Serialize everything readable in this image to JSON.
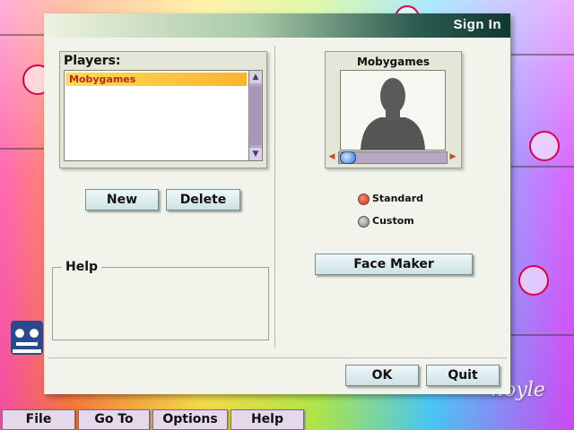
{
  "window": {
    "title": "Sign In"
  },
  "players": {
    "label": "Players:",
    "items": [
      "Mobygames"
    ],
    "selected_index": 0
  },
  "buttons": {
    "new": "New",
    "delete": "Delete",
    "face_maker": "Face Maker",
    "ok": "OK",
    "quit": "Quit"
  },
  "help": {
    "label": "Help",
    "text": ""
  },
  "face": {
    "name": "Mobygames"
  },
  "face_type": {
    "options": [
      "Standard",
      "Custom"
    ],
    "selected": "Standard"
  },
  "menu": {
    "items": [
      "File",
      "Go To",
      "Options",
      "Help"
    ]
  },
  "colors": {
    "accent": "#c02818",
    "title_dark": "#103830",
    "radio_selected": "#d02a1a"
  }
}
